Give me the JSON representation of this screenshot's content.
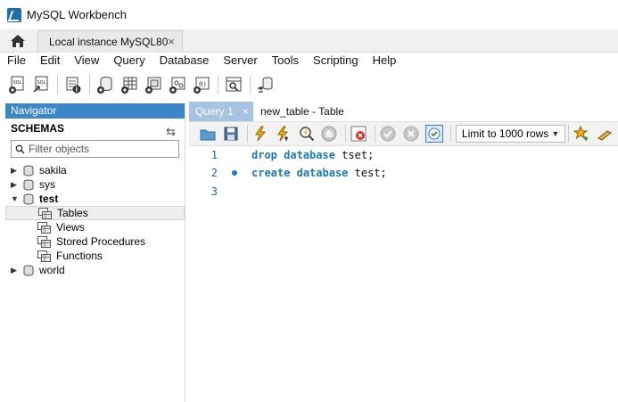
{
  "window": {
    "title": "MySQL Workbench"
  },
  "tabs": {
    "connection_tab": "Local instance MySQL80",
    "close_glyph": "×"
  },
  "menu": [
    "File",
    "Edit",
    "View",
    "Query",
    "Database",
    "Server",
    "Tools",
    "Scripting",
    "Help"
  ],
  "navigator": {
    "header": "Navigator",
    "schemas_label": "SCHEMAS",
    "filter_placeholder": "Filter objects",
    "schemas": [
      {
        "name": "sakila",
        "expanded": false
      },
      {
        "name": "sys",
        "expanded": false
      },
      {
        "name": "test",
        "expanded": true,
        "children": [
          "Tables",
          "Views",
          "Stored Procedures",
          "Functions"
        ]
      },
      {
        "name": "world",
        "expanded": false
      }
    ],
    "selected_child": "Tables"
  },
  "editor_tabs": {
    "query_tab": "Query 1",
    "table_tab": "new_table - Table",
    "close_glyph": "×"
  },
  "query_toolbar": {
    "limit_label": "Limit to 1000 rows"
  },
  "editor": {
    "lines": [
      {
        "num": "1",
        "kw1": "drop",
        "kw2": "database",
        "ident": "tset",
        "end": ";"
      },
      {
        "num": "2",
        "kw1": "create",
        "kw2": "database",
        "ident": "test",
        "end": ";",
        "marker": true
      },
      {
        "num": "3"
      }
    ]
  },
  "colors": {
    "navigator_header": "#3b86c6",
    "query_tab": "#a6c4e2",
    "keyword": "#1d7ab8"
  }
}
